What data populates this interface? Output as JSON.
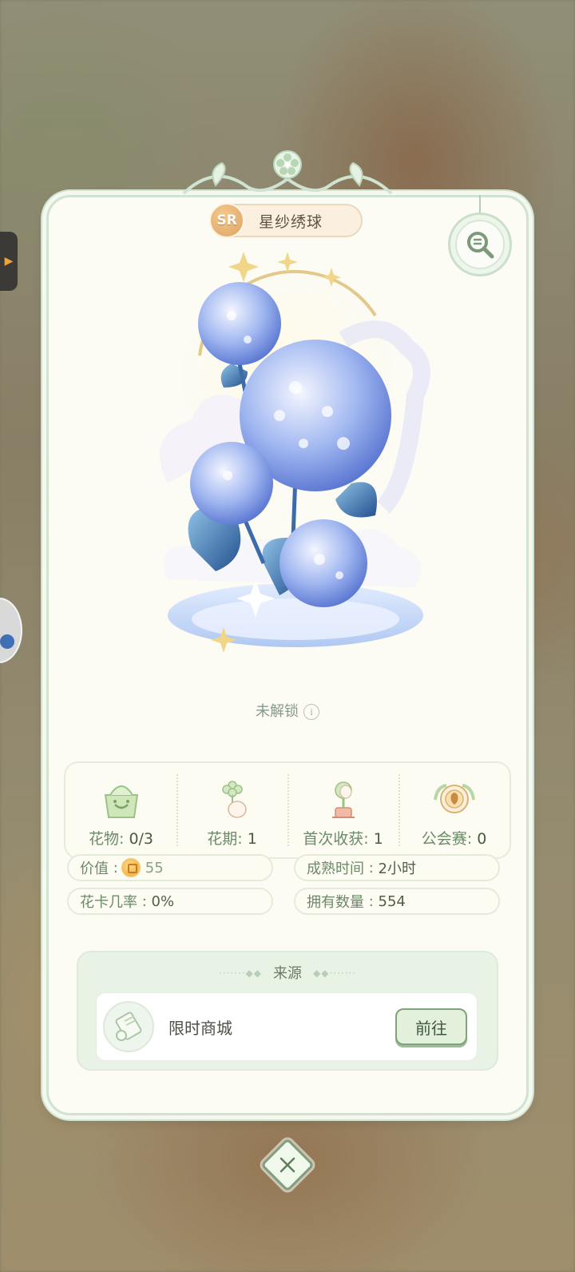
{
  "flower": {
    "rarity": "SR",
    "name": "星纱绣球",
    "status": "未解锁",
    "info_glyph": "i"
  },
  "stats": [
    {
      "icon": "flower-pot-icon",
      "label": "花物",
      "value": "0/3"
    },
    {
      "icon": "bloom-period-icon",
      "label": "花期",
      "value": "1"
    },
    {
      "icon": "first-harvest-icon",
      "label": "首次收获",
      "value": "1"
    },
    {
      "icon": "guild-match-icon",
      "label": "公会赛",
      "value": "0"
    }
  ],
  "details": {
    "value_label": "价值",
    "value": "55",
    "mature_label": "成熟时间",
    "mature": "2小时",
    "card_rate_label": "花卡几率",
    "card_rate": "0%",
    "owned_label": "拥有数量",
    "owned": "554"
  },
  "source": {
    "title": "来源",
    "items": [
      {
        "icon": "scroll-icon",
        "name": "限时商城",
        "button": "前往"
      }
    ]
  },
  "colors": {
    "card_bg": "#fcfbf4",
    "frame": "#cfe3d0",
    "accent_green": "#6b8a68",
    "rarity": "#dca365",
    "flower_blue": "#6f8fe0"
  }
}
